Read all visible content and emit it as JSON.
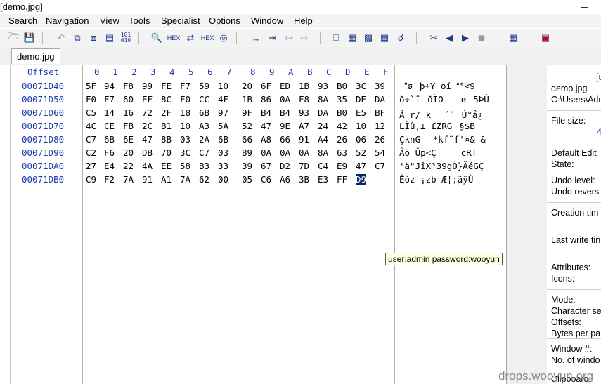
{
  "window": {
    "title": "[demo.jpg]"
  },
  "menu": [
    "Search",
    "Navigation",
    "View",
    "Tools",
    "Specialist",
    "Options",
    "Window",
    "Help"
  ],
  "toolbar": {
    "icons": [
      "undo-icon",
      "copy-icon",
      "cut-icon",
      "paste-icon",
      "paste-special-icon",
      "hex-binary-icon",
      "find-icon",
      "find-hex-icon",
      "replace-icon",
      "replace-hex-icon",
      "find-binoculars-icon",
      "goto-offset-icon",
      "goto-sector-icon",
      "back-arrow-icon",
      "forward-arrow-icon",
      "disk-icon",
      "ram-icon",
      "image-icon",
      "calculator-icon",
      "search-magnifier-icon",
      "scissors-icon",
      "prev-icon",
      "next-icon",
      "camera-icon",
      "table-icon",
      "book-icon"
    ]
  },
  "tab": {
    "label": "demo.jpg"
  },
  "editor": {
    "offset_header": "Offset",
    "columns": [
      "0",
      "1",
      "2",
      "3",
      "4",
      "5",
      "6",
      "7",
      "8",
      "9",
      "A",
      "B",
      "C",
      "D",
      "E",
      "F"
    ],
    "rows": [
      {
        "offset": "00071D40",
        "bytes": [
          "5F",
          "94",
          "F8",
          "99",
          "FE",
          "F7",
          "59",
          "10",
          "20",
          "6F",
          "ED",
          "1B",
          "93",
          "B0",
          "3C",
          "39"
        ],
        "text": "_øþ÷Y  oí °<9"
      },
      {
        "offset": "00071D50",
        "bytes": [
          "F0",
          "F7",
          "60",
          "EF",
          "8C",
          "F0",
          "CC",
          "4F",
          "1B",
          "86",
          "0A",
          "F8",
          "8A",
          "35",
          "DE",
          "DA"
        ],
        "text": "ð÷`ïðÌO  ø5ÞÚ"
      },
      {
        "offset": "00071D60",
        "bytes": [
          "C5",
          "14",
          "16",
          "72",
          "2F",
          "18",
          "6B",
          "97",
          "9F",
          "B4",
          "B4",
          "93",
          "DA",
          "B0",
          "E5",
          "BF"
        ],
        "text": "Å  r/ k´´Ú°å¿"
      },
      {
        "offset": "00071D70",
        "bytes": [
          "4C",
          "CE",
          "FB",
          "2C",
          "B1",
          "10",
          "A3",
          "5A",
          "52",
          "47",
          "9E",
          "A7",
          "24",
          "42",
          "10",
          "12"
        ],
        "text": "LÎû,± £ZRG§$B"
      },
      {
        "offset": "00071D80",
        "bytes": [
          "C7",
          "6B",
          "6E",
          "47",
          "8B",
          "03",
          "2A",
          "6B",
          "66",
          "A8",
          "66",
          "91",
          "A4",
          "26",
          "06",
          "26"
        ],
        "text": "ÇknG *kf¨f'¤& &"
      },
      {
        "offset": "00071D90",
        "bytes": [
          "C2",
          "F6",
          "20",
          "DB",
          "70",
          "3C",
          "C7",
          "03",
          "89",
          "0A",
          "0A",
          "0A",
          "8A",
          "63",
          "52",
          "54"
        ],
        "text": "Âö Ûp<Ç    cRT"
      },
      {
        "offset": "00071DA0",
        "bytes": [
          "27",
          "E4",
          "22",
          "4A",
          "EE",
          "58",
          "B3",
          "33",
          "39",
          "67",
          "D2",
          "7D",
          "C4",
          "E9",
          "47",
          "C7"
        ],
        "text": "'ä\"JîX³39gÒ}ÄéGÇ"
      },
      {
        "offset": "00071DB0",
        "bytes": [
          "C9",
          "F2",
          "7A",
          "91",
          "A1",
          "7A",
          "62",
          "00",
          "05",
          "C6",
          "A6",
          "3B",
          "E3",
          "FF",
          "D9",
          ""
        ],
        "text": "Éòz'¡zb  Æ¦;ãÿÙ"
      }
    ],
    "tooltip": "user:admin password:wooyun"
  },
  "details": {
    "rows": [
      "[u",
      "demo.jpg",
      "C:\\Users\\Adr",
      "File size:",
      "4",
      "Default Edit",
      "State:",
      "Undo level:",
      "Undo revers",
      "Creation tim",
      "Last write tin",
      "Attributes:",
      "Icons:",
      "Mode:",
      "Character se",
      "Offsets:",
      "Bytes per pa",
      "Window #:",
      "No. of windo",
      "Clipboard:"
    ]
  },
  "watermark": "drops.wooyun.org"
}
